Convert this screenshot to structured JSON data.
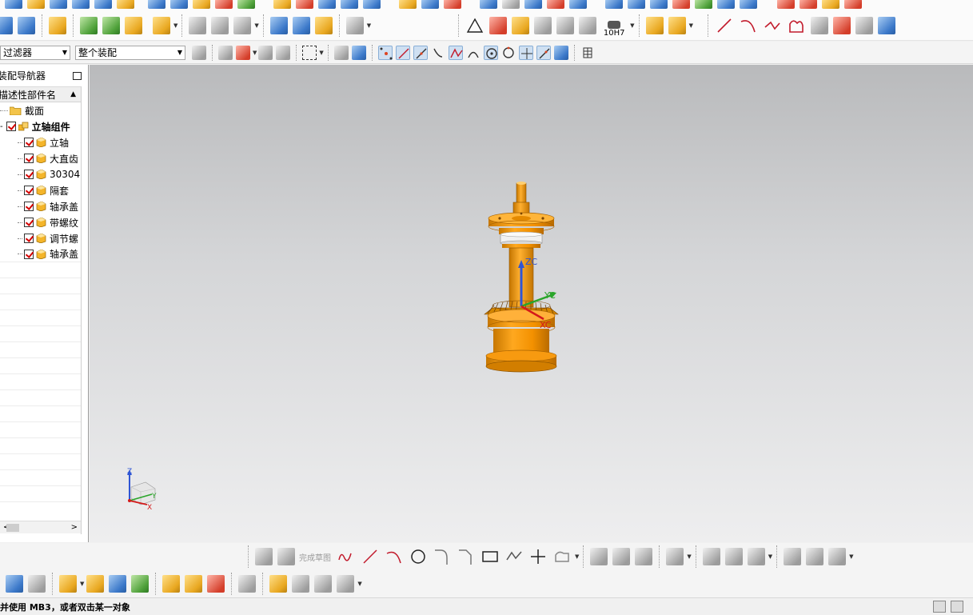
{
  "toolbar": {
    "selection_filter": "过滤器",
    "selection_scope": "整个装配",
    "tolerance_label": "10H7"
  },
  "navigator": {
    "title": "装配导航器",
    "column_header": "描述性部件名",
    "items": [
      {
        "label": "截面",
        "type": "folder"
      },
      {
        "label": "立轴组件",
        "type": "assembly",
        "checked": true
      },
      {
        "label": "立轴",
        "type": "part",
        "checked": true
      },
      {
        "label": "大直齿",
        "type": "part",
        "checked": true
      },
      {
        "label": "30304",
        "type": "part",
        "checked": true
      },
      {
        "label": "隔套",
        "type": "part",
        "checked": true
      },
      {
        "label": "轴承盖",
        "type": "part",
        "checked": true
      },
      {
        "label": "带螺纹",
        "type": "part",
        "checked": true
      },
      {
        "label": "调节螺",
        "type": "part",
        "checked": true
      },
      {
        "label": "轴承盖",
        "type": "part",
        "checked": true
      }
    ]
  },
  "viewport": {
    "wcs_z": "ZC",
    "wcs_y": "YC",
    "wcs_x": "XC",
    "triad_z": "Z",
    "triad_y": "Y",
    "triad_x": "X"
  },
  "sketch_toolbar": {
    "finish_sketch": "完成草图"
  },
  "status": {
    "message": "并使用 MB3，或者双击某一对象"
  },
  "colors": {
    "part_orange": "#f09a0a",
    "part_orange_dark": "#b86d00",
    "axis_blue": "#2f55d4",
    "axis_green": "#2aa52a",
    "axis_red": "#d41a1a"
  }
}
